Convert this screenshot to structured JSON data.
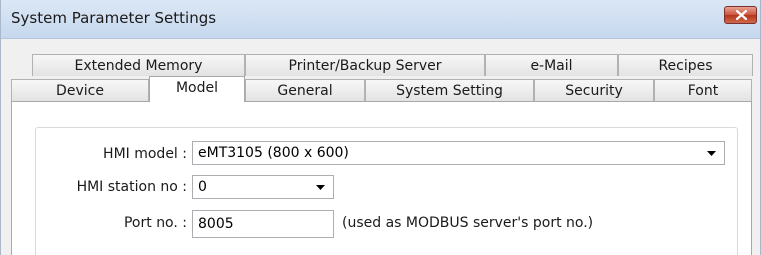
{
  "window": {
    "title": "System Parameter Settings"
  },
  "tabs": {
    "row1": [
      {
        "label": "Extended Memory"
      },
      {
        "label": "Printer/Backup Server"
      },
      {
        "label": "e-Mail"
      },
      {
        "label": "Recipes"
      }
    ],
    "row2": [
      {
        "label": "Device"
      },
      {
        "label": "Model",
        "active": true
      },
      {
        "label": "General"
      },
      {
        "label": "System Setting"
      },
      {
        "label": "Security"
      },
      {
        "label": "Font"
      }
    ]
  },
  "form": {
    "hmi_model_label": "HMI model :",
    "hmi_model_value": "eMT3105 (800 x 600)",
    "station_label": "HMI station no :",
    "station_value": "0",
    "port_label": "Port no. :",
    "port_value": "8005",
    "port_note": "(used as MODBUS server's port no.)"
  },
  "icons": {
    "close": "close-icon",
    "dropdown": "chevron-down-icon"
  }
}
